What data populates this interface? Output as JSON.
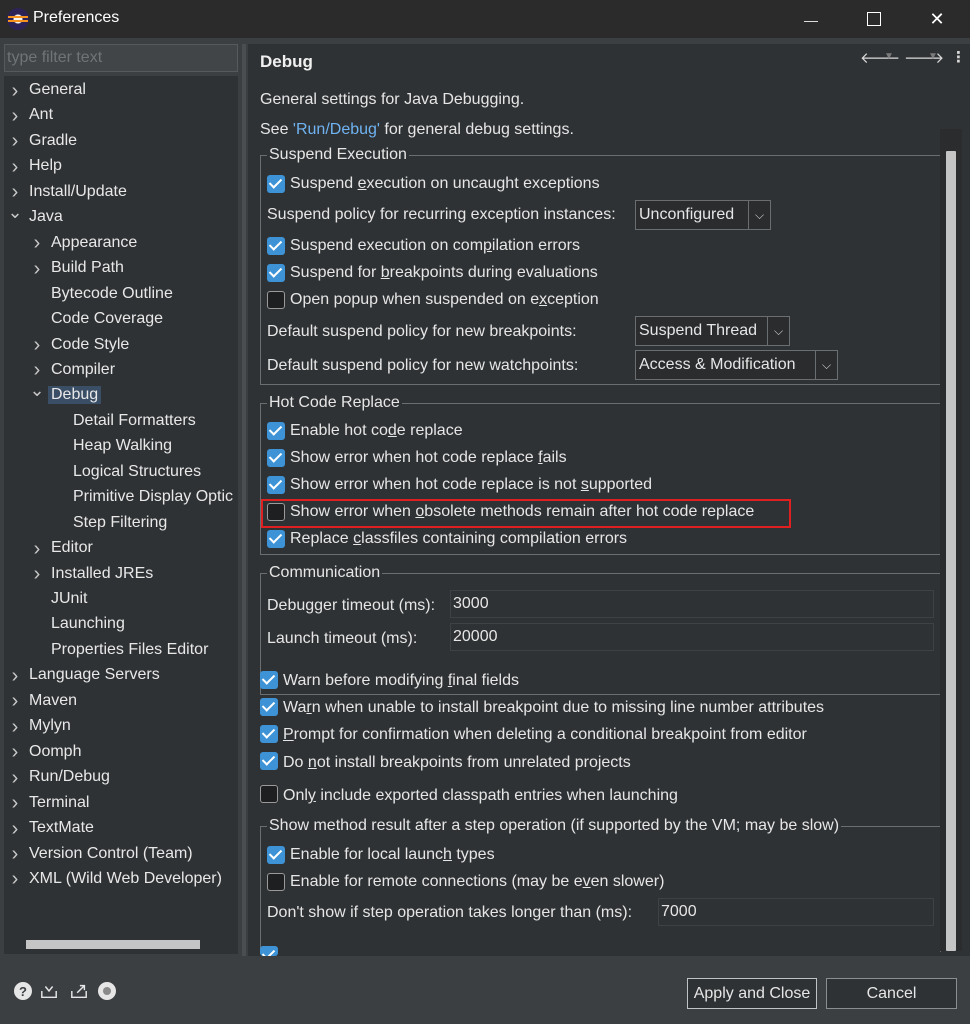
{
  "window": {
    "title": "Preferences"
  },
  "filter": {
    "placeholder": "type filter text"
  },
  "tree": {
    "items": [
      {
        "label": "General",
        "expandable": true,
        "expanded": false
      },
      {
        "label": "Ant",
        "expandable": true,
        "expanded": false
      },
      {
        "label": "Gradle",
        "expandable": true,
        "expanded": false
      },
      {
        "label": "Help",
        "expandable": true,
        "expanded": false
      },
      {
        "label": "Install/Update",
        "expandable": true,
        "expanded": false
      },
      {
        "label": "Java",
        "expandable": true,
        "expanded": true
      },
      {
        "label": "Appearance",
        "expandable": true,
        "expanded": false
      },
      {
        "label": "Build Path",
        "expandable": true,
        "expanded": false
      },
      {
        "label": "Bytecode Outline",
        "expandable": false
      },
      {
        "label": "Code Coverage",
        "expandable": false
      },
      {
        "label": "Code Style",
        "expandable": true,
        "expanded": false
      },
      {
        "label": "Compiler",
        "expandable": true,
        "expanded": false
      },
      {
        "label": "Debug",
        "expandable": true,
        "expanded": true,
        "selected": true
      },
      {
        "label": "Detail Formatters",
        "expandable": false
      },
      {
        "label": "Heap Walking",
        "expandable": false
      },
      {
        "label": "Logical Structures",
        "expandable": false
      },
      {
        "label": "Primitive Display Optic",
        "expandable": false
      },
      {
        "label": "Step Filtering",
        "expandable": false
      },
      {
        "label": "Editor",
        "expandable": true,
        "expanded": false
      },
      {
        "label": "Installed JREs",
        "expandable": true,
        "expanded": false
      },
      {
        "label": "JUnit",
        "expandable": false
      },
      {
        "label": "Launching",
        "expandable": false
      },
      {
        "label": "Properties Files Editor",
        "expandable": false
      },
      {
        "label": "Language Servers",
        "expandable": true,
        "expanded": false
      },
      {
        "label": "Maven",
        "expandable": true,
        "expanded": false
      },
      {
        "label": "Mylyn",
        "expandable": true,
        "expanded": false
      },
      {
        "label": "Oomph",
        "expandable": true,
        "expanded": false
      },
      {
        "label": "Run/Debug",
        "expandable": true,
        "expanded": false
      },
      {
        "label": "Terminal",
        "expandable": true,
        "expanded": false
      },
      {
        "label": "TextMate",
        "expandable": true,
        "expanded": false
      },
      {
        "label": "Version Control (Team)",
        "expandable": true,
        "expanded": false
      },
      {
        "label": "XML (Wild Web Developer)",
        "expandable": true,
        "expanded": false
      }
    ]
  },
  "page": {
    "title": "Debug",
    "intro": "General settings for Java Debugging.",
    "see_prefix": "See ",
    "see_link": "'Run/Debug'",
    "see_suffix": " for general debug settings."
  },
  "suspend": {
    "title": "Suspend Execution",
    "uncaught": {
      "pre": "Suspend ",
      "u": "e",
      "post": "xecution on uncaught exceptions",
      "checked": true
    },
    "policy_label": "Suspend policy for recurring exception instances:",
    "policy_value": "Unconfigured",
    "compilation": {
      "pre": "Suspend execution on com",
      "u": "p",
      "post": "ilation errors",
      "checked": true
    },
    "breakpoints_eval": {
      "pre": "Suspend for ",
      "u": "b",
      "post": "reakpoints during evaluations",
      "checked": true
    },
    "popup": {
      "pre": "Open popup when suspended on e",
      "u": "x",
      "post": "ception",
      "checked": false
    },
    "bp_policy_label": "Default suspend policy for new breakpoints:",
    "bp_policy_value": "Suspend Thread",
    "wp_policy_label": "Default suspend policy for new watchpoints:",
    "wp_policy_value": "Access & Modification"
  },
  "hcr": {
    "title": "Hot Code Replace",
    "enable": {
      "pre": "Enable hot co",
      "u": "d",
      "post": "e replace",
      "checked": true
    },
    "show_fails": {
      "pre": "Show error when hot code replace ",
      "u": "f",
      "post": "ails",
      "checked": true
    },
    "show_not_supported": {
      "pre": "Show error when hot code replace is not ",
      "u": "s",
      "post": "upported",
      "checked": true
    },
    "show_obsolete": {
      "pre": "Show error when ",
      "u": "o",
      "post": "bsolete methods remain after hot code replace",
      "checked": false
    },
    "replace_classfiles": {
      "pre": "Replace ",
      "u": "c",
      "post": "lassfiles containing compilation errors",
      "checked": true
    }
  },
  "communication": {
    "title": "Communication",
    "debugger_timeout_label": "Debugger timeout (ms):",
    "debugger_timeout_value": "3000",
    "launch_timeout_label": "Launch timeout (ms):",
    "launch_timeout_value": "20000"
  },
  "options": {
    "warn_final": {
      "pre": "Warn before modifying ",
      "u": "f",
      "post": "inal fields",
      "checked": true
    },
    "warn_line": {
      "pre": "Wa",
      "u": "r",
      "post": "n when unable to install breakpoint due to missing line number attributes",
      "checked": true
    },
    "prompt_conditional": {
      "pre": "",
      "u": "P",
      "post": "rompt for confirmation when deleting a conditional breakpoint from editor",
      "checked": true
    },
    "unrelated": {
      "pre": "Do ",
      "u": "n",
      "post": "ot install breakpoints from unrelated projects",
      "checked": true
    },
    "exported_only": {
      "pre": "Onl",
      "u": "y",
      "post": " include exported classpath entries when launching",
      "checked": false
    }
  },
  "method_result": {
    "title": "Show method result after a step operation (if supported by the VM; may be slow)",
    "local": {
      "pre": "Enable for local launc",
      "u": "h",
      "post": " types",
      "checked": true
    },
    "remote": {
      "pre": "Enable for remote connections (may be e",
      "u": "v",
      "post": "en slower)",
      "checked": false
    },
    "timeout_label": "Don't show if step operation takes longer than (ms):",
    "timeout_value": "7000"
  },
  "buttons": {
    "apply_close": "Apply and Close",
    "cancel": "Cancel"
  },
  "highlight_color": "#e02020",
  "accent_color": "#3d93d6"
}
